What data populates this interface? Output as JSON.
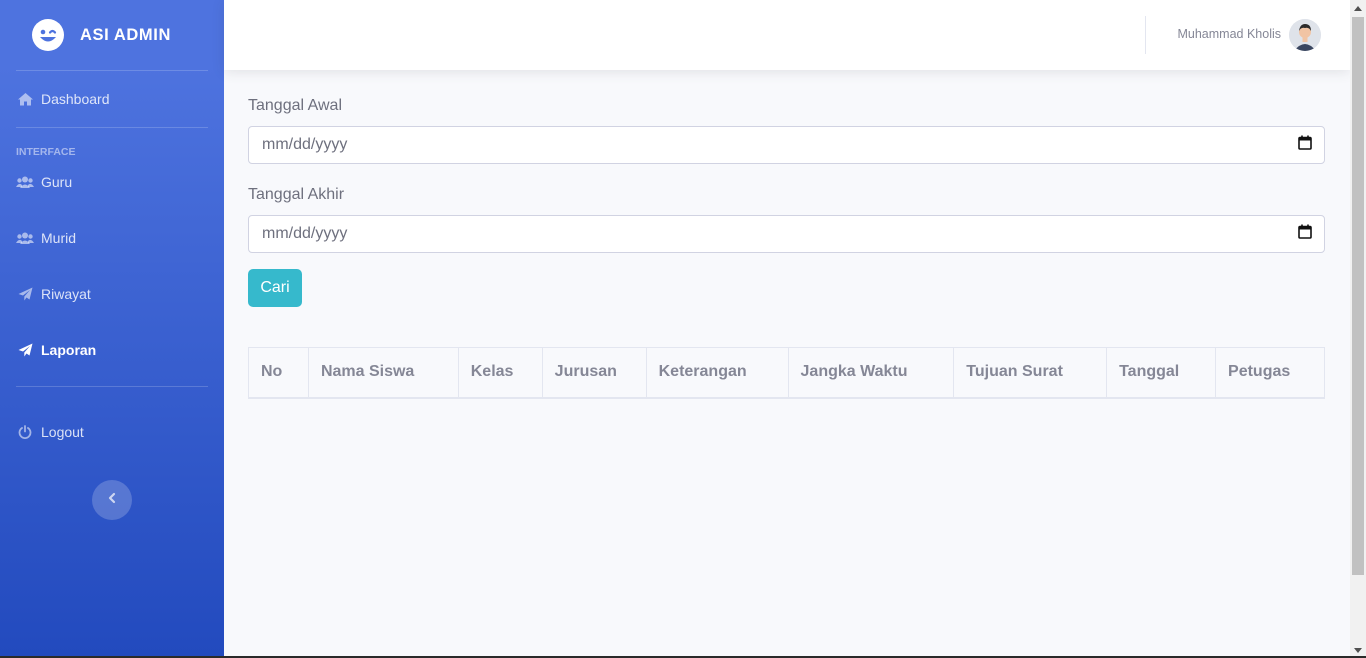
{
  "brand": {
    "icon": "laugh-wink-icon",
    "title": "ASI ADMIN"
  },
  "sidebar": {
    "dashboard": {
      "label": "Dashboard",
      "icon": "home-icon"
    },
    "heading": "INTERFACE",
    "items": [
      {
        "label": "Guru",
        "icon": "users-icon"
      },
      {
        "label": "Murid",
        "icon": "users-icon"
      },
      {
        "label": "Riwayat",
        "icon": "paper-plane-icon"
      },
      {
        "label": "Laporan",
        "icon": "paper-plane-icon",
        "active": true
      }
    ],
    "logout": {
      "label": "Logout",
      "icon": "power-icon"
    },
    "toggle_icon": "chevron-left-icon"
  },
  "topbar": {
    "user_name": "Muhammad Kholis",
    "avatar_icon": "user-avatar-icon"
  },
  "form": {
    "start_label": "Tanggal Awal",
    "start_value": "mm/dd/yyyy",
    "end_label": "Tanggal Akhir",
    "end_value": "mm/dd/yyyy",
    "submit_label": "Cari"
  },
  "table": {
    "headers": [
      "No",
      "Nama Siswa",
      "Kelas",
      "Jurusan",
      "Keterangan",
      "Jangka Waktu",
      "Tujuan Surat",
      "Tanggal",
      "Petugas"
    ],
    "rows": []
  },
  "colors": {
    "sidebar_start": "#4e73df",
    "sidebar_end": "#224abe",
    "info": "#36b9cc"
  }
}
